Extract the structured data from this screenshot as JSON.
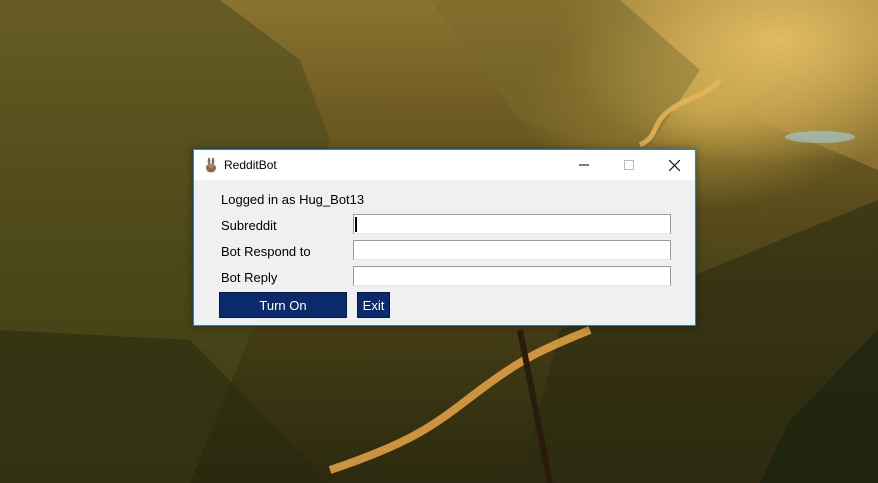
{
  "window": {
    "title": "RedditBot",
    "icon": "rabbit-app-icon"
  },
  "titlebar_controls": {
    "minimize_icon": "minimize-icon",
    "maximize_icon": "maximize-icon",
    "close_icon": "close-icon"
  },
  "status": {
    "logged_in_text": "Logged in as Hug_Bot13"
  },
  "form": {
    "subreddit_label": "Subreddit",
    "subreddit_value": "",
    "respond_label": "Bot Respond to",
    "respond_value": "",
    "reply_label": "Bot Reply",
    "reply_value": ""
  },
  "buttons": {
    "turn_on_label": "Turn On",
    "exit_label": "Exit"
  },
  "colors": {
    "button_bg": "#0a2a6b",
    "window_border": "#2a7fd0"
  }
}
